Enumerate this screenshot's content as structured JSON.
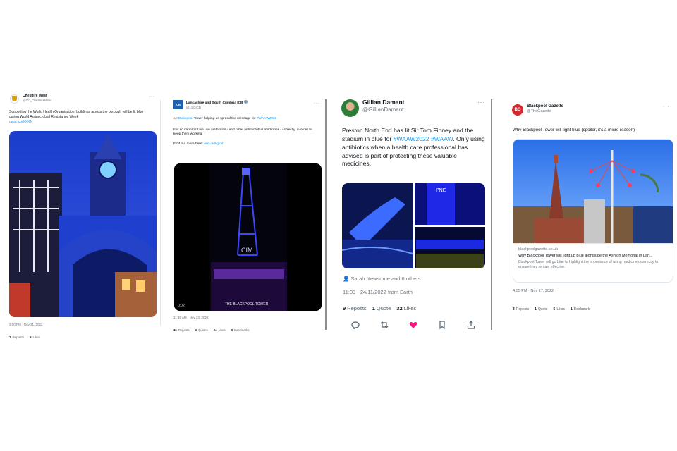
{
  "colors": {
    "link": "#1d9bf0",
    "like": "#f91880",
    "muted": "#6e767d",
    "divider": "#8d8d8d"
  },
  "tweets": [
    {
      "name": "Cheshire West",
      "handle": "@Go_CheshireWest",
      "text": "Supporting the World Health Organisation, buildings across the borough will be lit blue during World Antimicrobial Resistance Week",
      "link": "cwac.co/XXXN",
      "time": "3:00 PM · Nov 21, 2022",
      "stats": {
        "reposts_n": "2",
        "reposts_l": "Reposts",
        "likes_n": "6",
        "likes_l": "Likes"
      },
      "more": "···"
    },
    {
      "name": "Lancashire and South Cumbria ICB",
      "handle": "@LSCICB",
      "logo": "ICB",
      "text_pre": "",
      "hashtag1": "#Blackpool",
      "text_mid": " Tower helping us spread the message for ",
      "hashtag2": "#WAAW2022",
      "text2": "It is so important we use antibiotics - and other antimicrobial medicines - correctly, in order to keep them working.",
      "find_more": "Find out more here: ",
      "find_link": "orlo.uk/kgjnd",
      "video_time": "0:02",
      "sign": "THE BLACKPOOL TOWER",
      "time": "11:36 AM · Nov 23, 2022",
      "stats": {
        "reposts_n": "16",
        "reposts_l": "Reposts",
        "quotes_n": "4",
        "quotes_l": "Quotes",
        "likes_n": "24",
        "likes_l": "Likes",
        "bookmarks_n": "3",
        "bookmarks_l": "Bookmarks"
      },
      "more": "···"
    },
    {
      "name": "Gillian Damant",
      "handle": "@GillianDamant",
      "text_pre": "Preston North End has lit Sir Tom Finney and the stadium in blue for ",
      "hashtag1": "#WAAW2022",
      "text_mid": " ",
      "hashtag2": "#WAAW",
      "text_post": ". Only using antibiotics when a health care professional has advised is part of protecting these valuable medicines.",
      "tagged": "Sarah Newsome and 6 others",
      "time": "11:03 · 24/11/2022 from Earth",
      "stats": {
        "reposts_n": "9",
        "reposts_l": "Reposts",
        "quotes_n": "1",
        "quotes_l": "Quote",
        "likes_n": "32",
        "likes_l": "Likes"
      },
      "actions": [
        "reply-icon",
        "repost-icon",
        "like-icon",
        "bookmark-icon",
        "share-icon"
      ],
      "more": "···"
    },
    {
      "name": "Blackpool Gazette",
      "handle": "@TheGazette",
      "logo": "BG",
      "text": "Why Blackpool Tower will light blue (spoiler, it's a micro reason)",
      "link_domain": "blackpoolgazette.co.uk",
      "link_title": "Why Blackpool Tower will light up blue alongside the Ashton Memorial in Lan...",
      "link_desc": "Blackpool Tower will go blue to highlight the importance of using medicines correctly to ensure they remain effective.",
      "time": "4:35 PM · Nov 17, 2022",
      "stats": {
        "reposts_n": "3",
        "reposts_l": "Reposts",
        "quotes_n": "1",
        "quotes_l": "Quote",
        "likes_n": "5",
        "likes_l": "Likes",
        "bookmarks_n": "1",
        "bookmarks_l": "Bookmark"
      },
      "more": "···"
    }
  ]
}
